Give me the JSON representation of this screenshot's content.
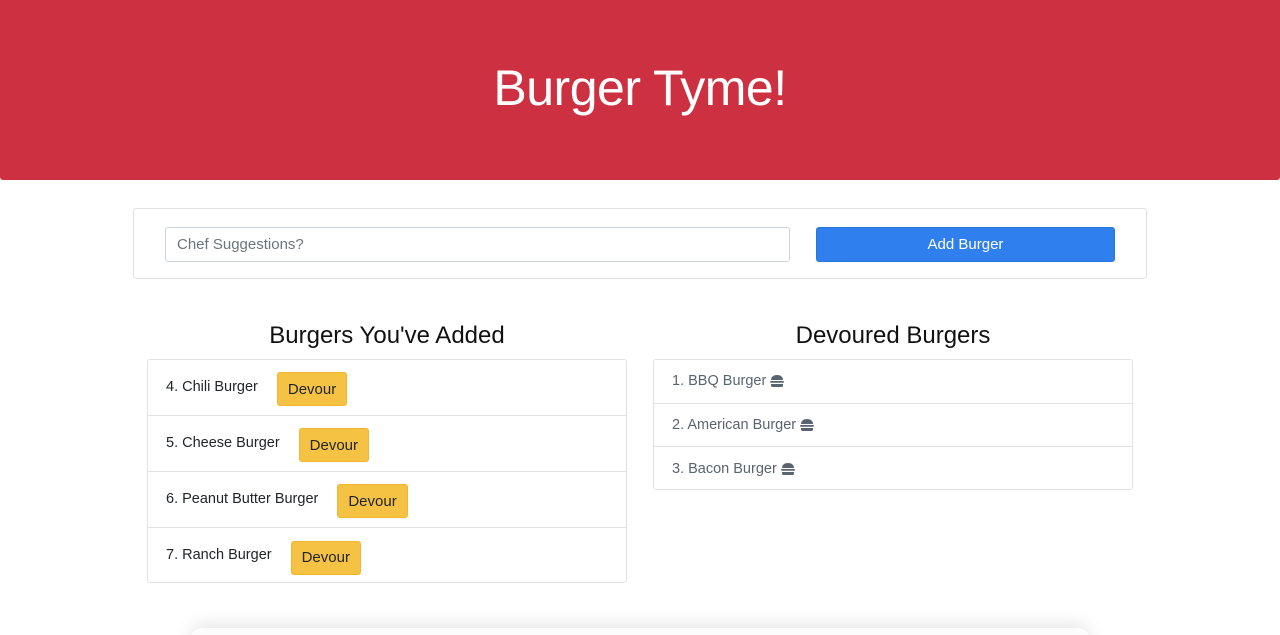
{
  "header": {
    "title": "Burger Tyme!"
  },
  "form": {
    "placeholder": "Chef Suggestions?",
    "value": "",
    "add_label": "Add Burger"
  },
  "added": {
    "title": "Burgers You've Added",
    "items": [
      {
        "label": "4. Chili Burger",
        "button": "Devour"
      },
      {
        "label": "5. Cheese Burger",
        "button": "Devour"
      },
      {
        "label": "6. Peanut Butter Burger",
        "button": "Devour"
      },
      {
        "label": "7. Ranch Burger",
        "button": "Devour"
      }
    ]
  },
  "devoured": {
    "title": "Devoured Burgers",
    "items": [
      {
        "label": "1. BBQ Burger",
        "icon": "hamburger-icon"
      },
      {
        "label": "2. American Burger",
        "icon": "hamburger-icon"
      },
      {
        "label": "3. Bacon Burger",
        "icon": "hamburger-icon"
      }
    ]
  },
  "colors": {
    "header_bg": "#cc3041",
    "primary": "#2f7fef",
    "warning": "#f6c244"
  }
}
